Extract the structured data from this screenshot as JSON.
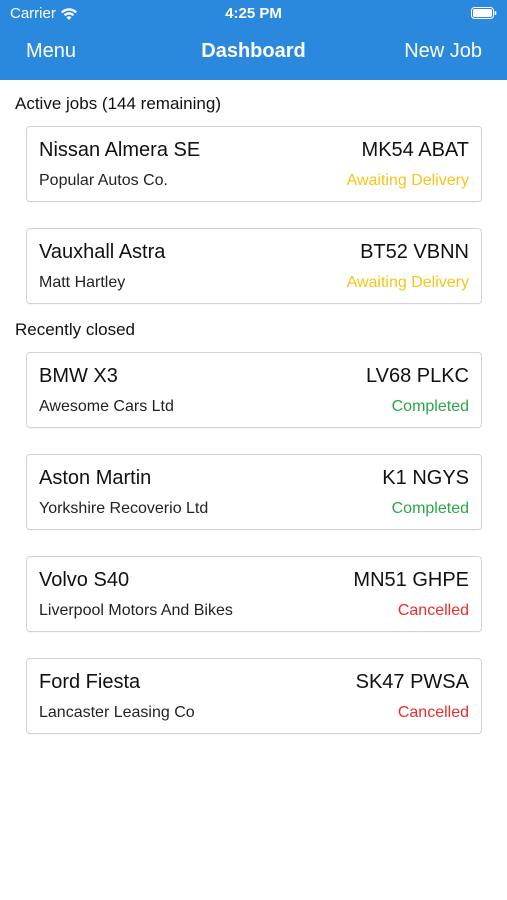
{
  "status_bar": {
    "carrier": "Carrier",
    "time": "4:25 PM"
  },
  "nav": {
    "left_label": "Menu",
    "title": "Dashboard",
    "right_label": "New Job"
  },
  "sections": {
    "active_header": "Active jobs (144 remaining)",
    "closed_header": "Recently closed"
  },
  "colors": {
    "nav_background": "#2a89dd",
    "awaiting": "#f5c518",
    "completed": "#2aa845",
    "cancelled": "#ee2b2b"
  },
  "active_jobs": [
    {
      "vehicle": "Nissan Almera SE",
      "reg": "MK54 ABAT",
      "customer": "Popular Autos Co.",
      "status": "Awaiting Delivery",
      "status_color": "#f5c518"
    },
    {
      "vehicle": "Vauxhall Astra",
      "reg": "BT52 VBNN",
      "customer": "Matt Hartley",
      "status": "Awaiting Delivery",
      "status_color": "#f5c518"
    }
  ],
  "closed_jobs": [
    {
      "vehicle": "BMW X3",
      "reg": "LV68 PLKC",
      "customer": "Awesome Cars Ltd",
      "status": "Completed",
      "status_color": "#2aa845"
    },
    {
      "vehicle": "Aston Martin",
      "reg": "K1 NGYS",
      "customer": "Yorkshire Recoverio Ltd",
      "status": "Completed",
      "status_color": "#2aa845"
    },
    {
      "vehicle": "Volvo S40",
      "reg": "MN51 GHPE",
      "customer": "Liverpool Motors And Bikes",
      "status": "Cancelled",
      "status_color": "#ee2b2b"
    },
    {
      "vehicle": "Ford Fiesta",
      "reg": "SK47 PWSA",
      "customer": "Lancaster Leasing Co",
      "status": "Cancelled",
      "status_color": "#ee2b2b"
    }
  ]
}
